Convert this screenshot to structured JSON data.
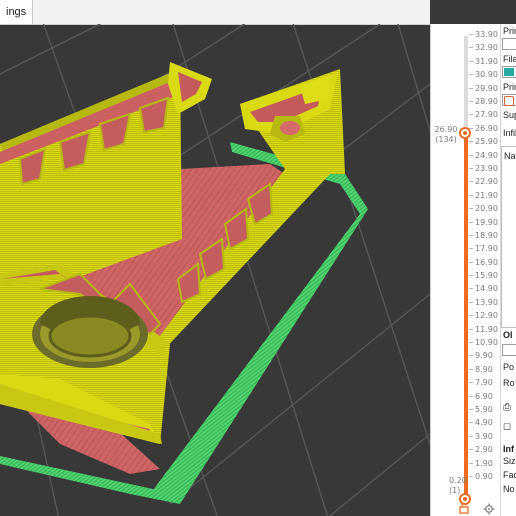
{
  "tab": {
    "label": "ings"
  },
  "layer_slider": {
    "ticks": [
      "33.90",
      "32.90",
      "31.90",
      "30.90",
      "29.90",
      "28.90",
      "27.90",
      "26.90",
      "25.90",
      "24.90",
      "23.90",
      "22.90",
      "21.90",
      "20.90",
      "19.90",
      "18.90",
      "17.90",
      "16.90",
      "15.90",
      "14.90",
      "13.90",
      "12.90",
      "11.90",
      "10.90",
      "9.90",
      "8.90",
      "7.90",
      "6.90",
      "5.90",
      "4.90",
      "3.90",
      "2.90",
      "1.90",
      "0.90"
    ],
    "upper_height": "26.90",
    "upper_layer": "(134)",
    "lower_height": "0.20",
    "lower_layer": "(1)",
    "upper_level_fraction": 0.79,
    "accent_color": "#ed6b21"
  },
  "side_panel": {
    "print_settings_label": "Print",
    "filament_label": "Filar",
    "printer_label": "Printe",
    "supports_label": "Supp",
    "infill_label": "Infill",
    "name_header": "Na",
    "object_manipulation_label": "Ol",
    "position_label": "Po",
    "rotation_label": "Ro",
    "info_label": "Inf",
    "size_label": "Size",
    "facets_label": "Fac",
    "no_label": "No",
    "filament_color": "#27a9a3",
    "printer_color": "#e0643a"
  },
  "colors": {
    "background": "#383838",
    "grid": "#555555",
    "perimeter": "#dede18",
    "infill": "#d46a6a",
    "skirt": "#4ecf6d"
  }
}
